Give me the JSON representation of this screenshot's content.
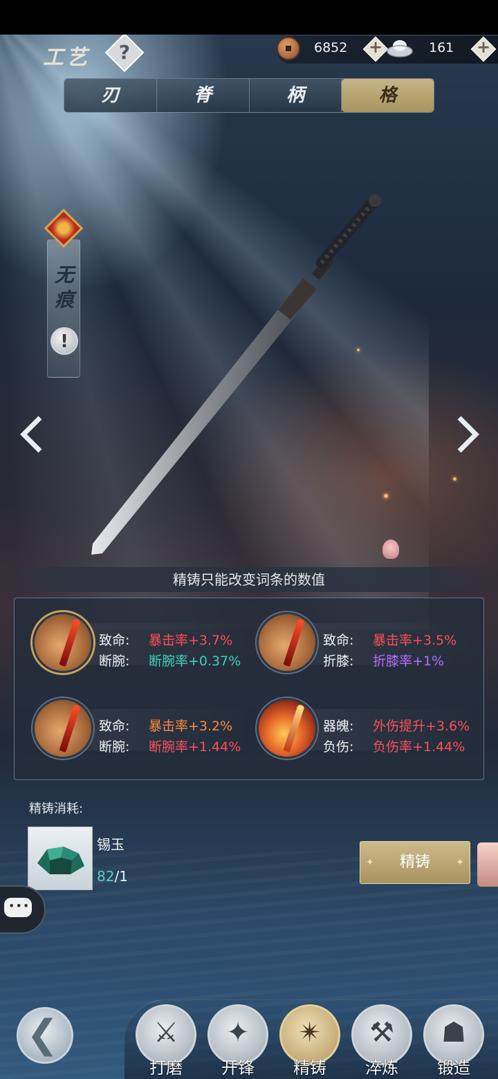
{
  "header": {
    "title": "工艺",
    "help_icon": "question-icon",
    "currencies": [
      {
        "name": "铜钱",
        "icon": "copper-coin-icon",
        "value": "6852"
      },
      {
        "name": "银两",
        "icon": "silver-ingot-icon",
        "value": "161"
      }
    ]
  },
  "tabs": [
    {
      "label": "刃",
      "active": false
    },
    {
      "label": "脊",
      "active": false
    },
    {
      "label": "柄",
      "active": false
    },
    {
      "label": "格",
      "active": true
    }
  ],
  "weapon": {
    "name": "无痕",
    "info_icon": "exclamation-icon"
  },
  "notice": "精铸只能改变词条的数值",
  "affixes": [
    {
      "label1": "致命:",
      "value1": "暴击率+3.7%",
      "color1": "#ff4d55",
      "label2": "断腕:",
      "value2": "断腕率+0.37%",
      "color2": "#3fd0b6",
      "selected": true,
      "icon": "blade-orb-icon"
    },
    {
      "label1": "致命:",
      "value1": "暴击率+3.5%",
      "color1": "#ff4d55",
      "label2": "折膝:",
      "value2": "折膝率+1%",
      "color2": "#b56cff",
      "selected": false,
      "icon": "blade-orb-icon"
    },
    {
      "label1": "致命:",
      "value1": "暴击率+3.2%",
      "color1": "#ff8a3c",
      "label2": "断腕:",
      "value2": "断腕率+1.44%",
      "color2": "#ff4d55",
      "selected": false,
      "icon": "blade-orb-icon"
    },
    {
      "label1": "器魄:",
      "value1": "外伤提升+3.6%",
      "color1": "#ff4d55",
      "label2": "负伤:",
      "value2": "负伤率+1.44%",
      "color2": "#ff4d55",
      "selected": false,
      "icon": "fire-orb-icon"
    }
  ],
  "cost": {
    "title": "精铸消耗:",
    "item_name": "锡玉",
    "have": "82",
    "need": "/1",
    "item_icon": "jade-icon"
  },
  "refine_button": "精铸",
  "bottom_nav": [
    {
      "label": "打磨",
      "icon": "grind-icon",
      "active": false
    },
    {
      "label": "开锋",
      "icon": "sharpen-icon",
      "active": false
    },
    {
      "label": "精铸",
      "icon": "refine-icon",
      "active": true
    },
    {
      "label": "淬炼",
      "icon": "temper-icon",
      "active": false
    },
    {
      "label": "锻造",
      "icon": "forge-icon",
      "active": false
    }
  ]
}
